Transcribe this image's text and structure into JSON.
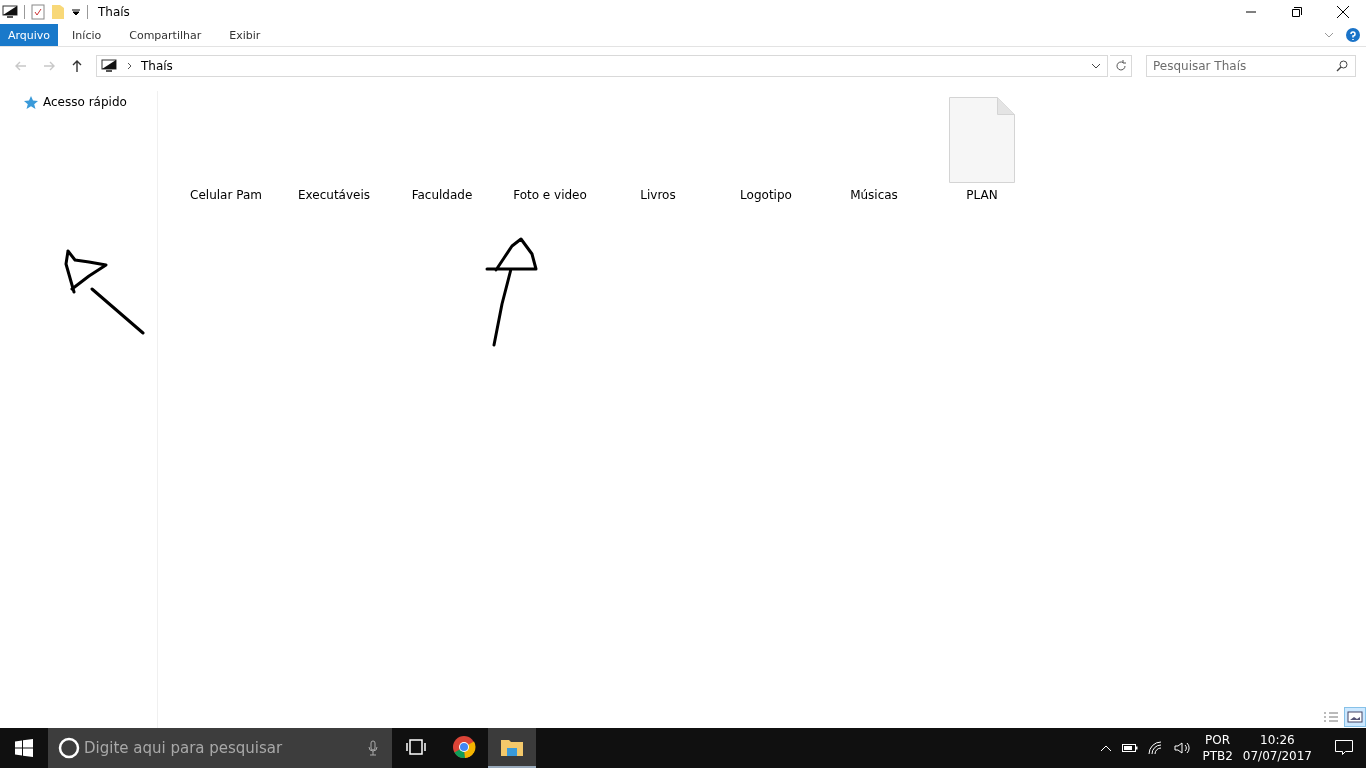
{
  "window": {
    "title": "Thaís"
  },
  "ribbon_tabs": [
    {
      "label": "Arquivo",
      "kind": "file"
    },
    {
      "label": "Início",
      "kind": "tab"
    },
    {
      "label": "Compartilhar",
      "kind": "tab"
    },
    {
      "label": "Exibir",
      "kind": "tab"
    }
  ],
  "nav_buttons": [
    {
      "kind": "back",
      "disabled": true
    },
    {
      "kind": "forward",
      "disabled": true
    },
    {
      "kind": "up",
      "disabled": false
    }
  ],
  "address": {
    "path": "Thaís"
  },
  "search": {
    "placeholder": "Pesquisar Thaís"
  },
  "sidebar": {
    "items": [
      {
        "label": "Acesso rápido"
      }
    ]
  },
  "items": [
    {
      "name": "Celular Pam",
      "kind": "folder"
    },
    {
      "name": "Executáveis",
      "kind": "folder"
    },
    {
      "name": "Faculdade",
      "kind": "folder"
    },
    {
      "name": "Foto e video",
      "kind": "folder"
    },
    {
      "name": "Livros",
      "kind": "folder"
    },
    {
      "name": "Logotipo",
      "kind": "folder"
    },
    {
      "name": "Músicas",
      "kind": "folder"
    },
    {
      "name": "PLAN",
      "kind": "file"
    }
  ],
  "view_buttons": [
    {
      "kind": "details",
      "selected": false
    },
    {
      "kind": "large-icons",
      "selected": true
    }
  ],
  "taskbar": {
    "search_placeholder": "Digite aqui para pesquisar",
    "apps": [
      {
        "kind": "task-view",
        "active": false
      },
      {
        "kind": "browser",
        "active": false
      },
      {
        "kind": "explorer",
        "active": true
      }
    ],
    "language": "POR",
    "layout": "PTB2",
    "time": "10:26",
    "date": "07/07/2017"
  }
}
